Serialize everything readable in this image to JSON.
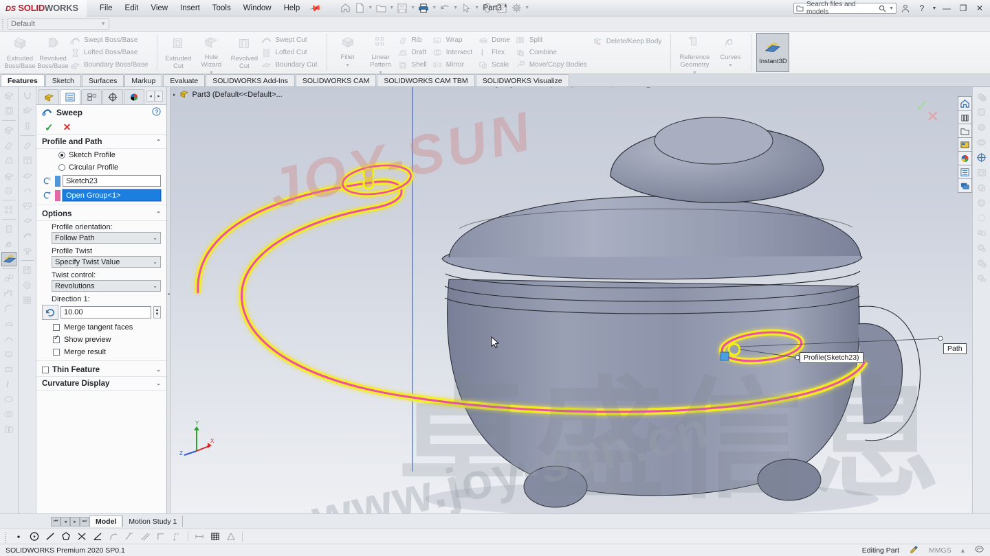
{
  "titlebar": {
    "logo_ds": "DS",
    "logo_sw": "SOLID",
    "logo_works": "WORKS",
    "menus": [
      "File",
      "Edit",
      "View",
      "Insert",
      "Tools",
      "Window",
      "Help"
    ],
    "pin_icon": "pushpin-icon",
    "quick_access": [
      "home-icon",
      "new-document-icon",
      "open-document-icon",
      "save-icon",
      "print-icon",
      "undo-icon",
      "select-icon",
      "rebuild-icon",
      "file-properties-icon",
      "options-gear-icon"
    ],
    "document_title": "Part3 *",
    "search_placeholder": "Search files and models",
    "search_icon": "magnifier-icon",
    "account_icon": "user-account-icon",
    "help_icon": "question-mark-icon",
    "minimize_label": "—",
    "restore_label": "❐",
    "close_label": "✕"
  },
  "configbar": {
    "config_value": "Default"
  },
  "ribbon": {
    "groups": [
      {
        "big": [
          {
            "label1": "Extruded",
            "label2": "Boss/Base",
            "icon": "extruded-boss-icon"
          },
          {
            "label1": "Revolved",
            "label2": "Boss/Base",
            "icon": "revolved-boss-icon"
          }
        ],
        "small": [
          {
            "label": "Swept Boss/Base",
            "icon": "swept-boss-icon"
          },
          {
            "label": "Lofted Boss/Base",
            "icon": "lofted-boss-icon"
          },
          {
            "label": "Boundary Boss/Base",
            "icon": "boundary-boss-icon"
          }
        ]
      },
      {
        "big": [
          {
            "label1": "Extruded",
            "label2": "Cut",
            "icon": "extruded-cut-icon"
          },
          {
            "label1": "Hole",
            "label2": "Wizard",
            "icon": "hole-wizard-icon",
            "dropdown": true
          },
          {
            "label1": "Revolved",
            "label2": "Cut",
            "icon": "revolved-cut-icon"
          }
        ],
        "small": [
          {
            "label": "Swept Cut",
            "icon": "swept-cut-icon"
          },
          {
            "label": "Lofted Cut",
            "icon": "lofted-cut-icon"
          },
          {
            "label": "Boundary Cut",
            "icon": "boundary-cut-icon"
          }
        ]
      },
      {
        "big": [
          {
            "label1": "Fillet",
            "label2": "",
            "icon": "fillet-icon",
            "dropdown": true
          },
          {
            "label1": "Linear",
            "label2": "Pattern",
            "icon": "linear-pattern-icon",
            "dropdown": true
          }
        ],
        "small": [
          {
            "label": "Rib",
            "icon": "rib-icon"
          },
          {
            "label": "Draft",
            "icon": "draft-icon"
          },
          {
            "label": "Shell",
            "icon": "shell-icon"
          }
        ],
        "small2": [
          {
            "label": "Wrap",
            "icon": "wrap-icon"
          },
          {
            "label": "Intersect",
            "icon": "intersect-icon"
          },
          {
            "label": "Mirror",
            "icon": "mirror-icon"
          }
        ],
        "small3": [
          {
            "label": "Dome",
            "icon": "dome-icon"
          },
          {
            "label": "Flex",
            "icon": "flex-icon"
          },
          {
            "label": "Scale",
            "icon": "scale-icon"
          }
        ],
        "small4": [
          {
            "label": "Split",
            "icon": "split-icon"
          },
          {
            "label": "Combine",
            "icon": "combine-icon"
          },
          {
            "label": "Move/Copy Bodies",
            "icon": "move-copy-bodies-icon"
          }
        ],
        "small5": [
          {
            "label": "Delete/Keep Body",
            "icon": "delete-keep-body-icon"
          }
        ]
      },
      {
        "big": [
          {
            "label1": "Reference",
            "label2": "Geometry",
            "icon": "reference-geometry-icon",
            "dropdown": true
          },
          {
            "label1": "Curves",
            "label2": "",
            "icon": "curves-icon",
            "dropdown": true
          }
        ]
      }
    ],
    "instant3d": {
      "label": "Instant3D",
      "icon": "instant3d-icon",
      "active": true
    }
  },
  "command_tabs": [
    {
      "label": "Features",
      "active": true
    },
    {
      "label": "Sketch",
      "active": false
    },
    {
      "label": "Surfaces",
      "active": false
    },
    {
      "label": "Markup",
      "active": false
    },
    {
      "label": "Evaluate",
      "active": false
    },
    {
      "label": "SOLIDWORKS Add-Ins",
      "active": false
    },
    {
      "label": "SOLIDWORKS CAM",
      "active": false
    },
    {
      "label": "SOLIDWORKS CAM TBM",
      "active": false
    },
    {
      "label": "SOLIDWORKS Visualize",
      "active": false
    }
  ],
  "property_manager": {
    "tabs": [
      {
        "icon": "feature-tree-icon",
        "active": false
      },
      {
        "icon": "property-manager-icon",
        "active": true
      },
      {
        "icon": "configuration-manager-icon",
        "active": false
      },
      {
        "icon": "dimxpert-manager-icon",
        "active": false
      },
      {
        "icon": "display-manager-icon",
        "active": false
      }
    ],
    "nav_prev": "◂",
    "nav_next": "▸",
    "title": "Sweep",
    "title_icon": "sweep-icon",
    "help_icon": "help-question-icon",
    "ok_icon": "✓",
    "cancel_icon": "✕",
    "sections": {
      "profile_and_path": {
        "title": "Profile and Path",
        "chevron": "⌃",
        "radio_sketch_profile": {
          "label": "Sketch Profile",
          "selected": true
        },
        "radio_circular_profile": {
          "label": "Circular Profile",
          "selected": false
        },
        "profile_field": {
          "value": "Sketch23",
          "icon": "profile-selector-icon",
          "swatch": "#4f95d8"
        },
        "path_field": {
          "value": "Open Group<1>",
          "icon": "path-selector-icon",
          "swatch": "#e268a8",
          "selected": true
        }
      },
      "options": {
        "title": "Options",
        "chevron": "⌃",
        "profile_orientation": {
          "label": "Profile orientation:",
          "value": "Follow Path"
        },
        "profile_twist": {
          "label": "Profile Twist",
          "value": "Specify Twist Value"
        },
        "twist_control": {
          "label": "Twist control:",
          "value": "Revolutions"
        },
        "direction1": {
          "label": "Direction 1:",
          "value": "10.00",
          "icon": "twist-direction-icon"
        },
        "merge_tangent_faces": {
          "label": "Merge tangent faces",
          "checked": false
        },
        "show_preview": {
          "label": "Show preview",
          "checked": true
        },
        "merge_result": {
          "label": "Merge result",
          "checked": false
        }
      },
      "thin_feature": {
        "title": "Thin Feature",
        "checked": false,
        "chevron": "⌄"
      },
      "curvature_display": {
        "title": "Curvature Display",
        "chevron": "⌄"
      }
    }
  },
  "viewport": {
    "tree_root": "Part3  (Default<<Default>...",
    "tree_arrow": "▸",
    "tree_icon": "part-icon",
    "heads_up": [
      "zoom-to-fit-icon",
      "zoom-to-area-icon",
      "previous-view-icon",
      "section-view-icon",
      "view-orientation-icon",
      "display-style-icon",
      "hide-show-items-icon",
      "edit-appearance-icon",
      "apply-scene-icon",
      "view-settings-icon"
    ],
    "window_controls": [
      "restore-down-icon",
      "maximize-icon",
      "minimize-icon",
      "restore-icon",
      "close-icon"
    ],
    "confirm_ok": "✓",
    "confirm_cancel": "✕",
    "callouts": [
      {
        "label": "Profile(Sketch23)",
        "name": "profile-callout"
      },
      {
        "label": "Path",
        "name": "path-callout"
      }
    ],
    "triad_axes": {
      "x": "X",
      "y": "Y",
      "z": "Z"
    },
    "cursor_icon": "arrow-cursor",
    "watermarks": {
      "chinese": "卓盛信息",
      "url": "www.joy-sun.cn",
      "brand": "JOY-SUN"
    },
    "colors": {
      "model_body": "#8b91a8",
      "preview_path": "#e8e800",
      "preview_core": "#e8559c",
      "background_top": "#c6cbd8",
      "background_bottom": "#eef0f4"
    }
  },
  "right_rail_top": [
    {
      "icon": "home-icon",
      "active": true
    },
    {
      "icon": "design-library-icon",
      "active": false
    },
    {
      "icon": "file-explorer-icon",
      "active": false
    },
    {
      "icon": "view-palette-icon",
      "active": false
    },
    {
      "icon": "appearances-scenes-icon",
      "active": false
    },
    {
      "icon": "custom-properties-icon",
      "active": false
    },
    {
      "icon": "solidworks-forum-icon",
      "active": false
    }
  ],
  "right_rail_tools": [
    "applied-appearance-icon",
    "edit-material-icon",
    "appearance-tool-icon",
    "scene-tool-icon",
    "camera-icon",
    "light-icon",
    "decal-icon",
    "sphere-tool-icon",
    "render-region-icon",
    "render-tools-icon",
    "render-options-icon",
    "schedule-render-icon",
    "render-final-icon"
  ],
  "bottom": {
    "nav_buttons": [
      "⏮",
      "◂",
      "▸",
      "⏭"
    ],
    "tabs": [
      {
        "label": "Model",
        "active": true
      },
      {
        "label": "Motion Study 1",
        "active": false
      }
    ],
    "sketch_tools": [
      "point-icon",
      "circle-icon",
      "line-icon",
      "polygon-icon",
      "trim-icon",
      "angle-icon",
      "tangent-arc-icon",
      "mirror-entities-icon",
      "offset-entities-icon",
      "corner-rectangle-icon",
      "path-dimension-icon",
      "smart-dimension-icon",
      "grid-icon",
      "angle-dim-icon"
    ]
  },
  "statusbar": {
    "version": "SOLIDWORKS Premium 2020 SP0.1",
    "mode": "Editing Part",
    "mode_icon": "editing-part-icon",
    "units": "MMGS",
    "units_caret": "▴",
    "overlay_icon": "overlay-icon"
  }
}
